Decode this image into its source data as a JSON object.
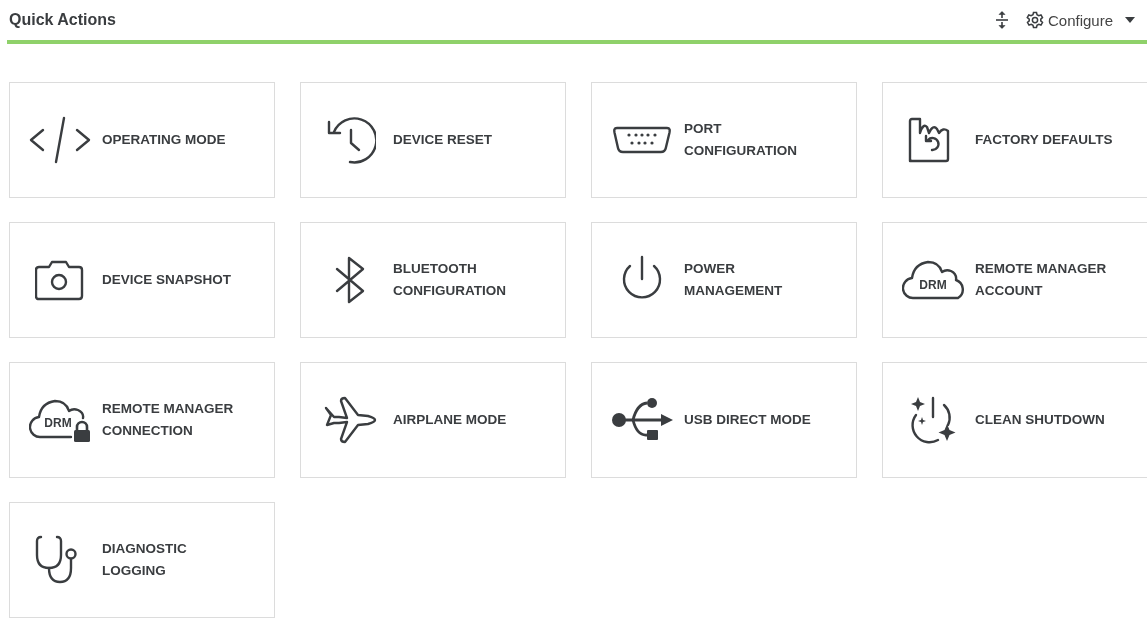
{
  "header": {
    "title": "Quick Actions",
    "configure_label": "Configure"
  },
  "actions": [
    {
      "kind": "code",
      "label_lines": [
        "OPERATING MODE"
      ]
    },
    {
      "kind": "history",
      "label_lines": [
        "DEVICE RESET"
      ]
    },
    {
      "kind": "serial-port",
      "label_lines": [
        "PORT",
        "CONFIGURATION"
      ]
    },
    {
      "kind": "factory",
      "label_lines": [
        "FACTORY DEFAULTS"
      ]
    },
    {
      "kind": "camera",
      "label_lines": [
        "DEVICE SNAPSHOT"
      ]
    },
    {
      "kind": "bluetooth",
      "label_lines": [
        "BLUETOOTH",
        "CONFIGURATION"
      ]
    },
    {
      "kind": "power",
      "label_lines": [
        "POWER",
        "MANAGEMENT"
      ]
    },
    {
      "kind": "cloud",
      "icon_text": "DRM",
      "label_lines": [
        "REMOTE MANAGER",
        "ACCOUNT"
      ]
    },
    {
      "kind": "cloud-lock",
      "icon_text": "DRM",
      "label_lines": [
        "REMOTE MANAGER",
        "CONNECTION"
      ]
    },
    {
      "kind": "airplane",
      "label_lines": [
        "AIRPLANE MODE"
      ]
    },
    {
      "kind": "usb",
      "label_lines": [
        "USB DIRECT MODE"
      ]
    },
    {
      "kind": "clean-power",
      "label_lines": [
        "CLEAN SHUTDOWN"
      ]
    },
    {
      "kind": "stethoscope",
      "label_lines": [
        "DIAGNOSTIC",
        "LOGGING"
      ]
    }
  ]
}
